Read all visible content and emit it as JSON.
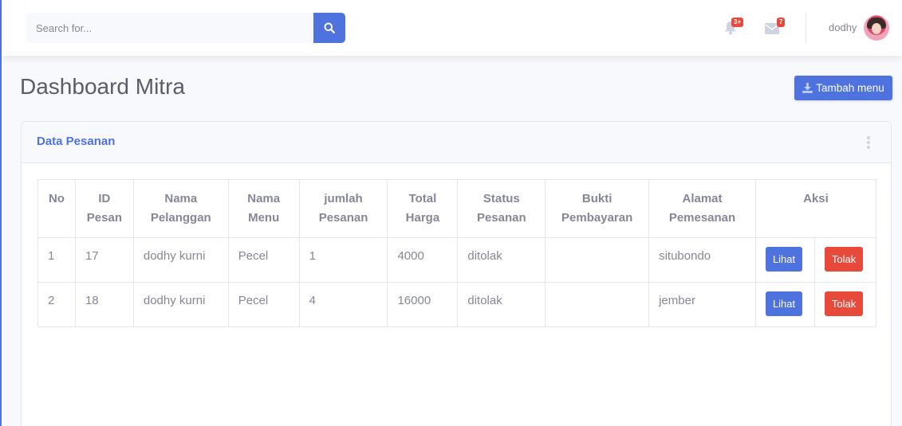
{
  "topbar": {
    "search_placeholder": "Search for...",
    "alerts_count": "3+",
    "messages_count": "7",
    "username": "dodhy"
  },
  "page": {
    "title": "Dashboard Mitra",
    "add_button_label": "Tambah menu"
  },
  "card": {
    "title": "Data Pesanan"
  },
  "table": {
    "headers": [
      "No",
      "ID Pesan",
      "Nama Pelanggan",
      "Nama Menu",
      "jumlah Pesanan",
      "Total Harga",
      "Status Pesanan",
      "Bukti Pembayaran",
      "Alamat Pemesanan",
      "Aksi"
    ],
    "rows": [
      {
        "no": "1",
        "id": "17",
        "pelanggan": "dodhy kurni",
        "menu": "Pecel",
        "jumlah": "1",
        "total": "4000",
        "status": "ditolak",
        "bukti": "",
        "alamat": "situbondo",
        "lihat": "Lihat",
        "tolak": "Tolak"
      },
      {
        "no": "2",
        "id": "18",
        "pelanggan": "dodhy kurni",
        "menu": "Pecel",
        "jumlah": "4",
        "total": "16000",
        "status": "ditolak",
        "bukti": "",
        "alamat": "jember",
        "lihat": "Lihat",
        "tolak": "Tolak"
      }
    ]
  },
  "colors": {
    "primary": "#4e73df",
    "danger": "#e74a3b",
    "text": "#858796",
    "heading": "#5a5c69"
  }
}
